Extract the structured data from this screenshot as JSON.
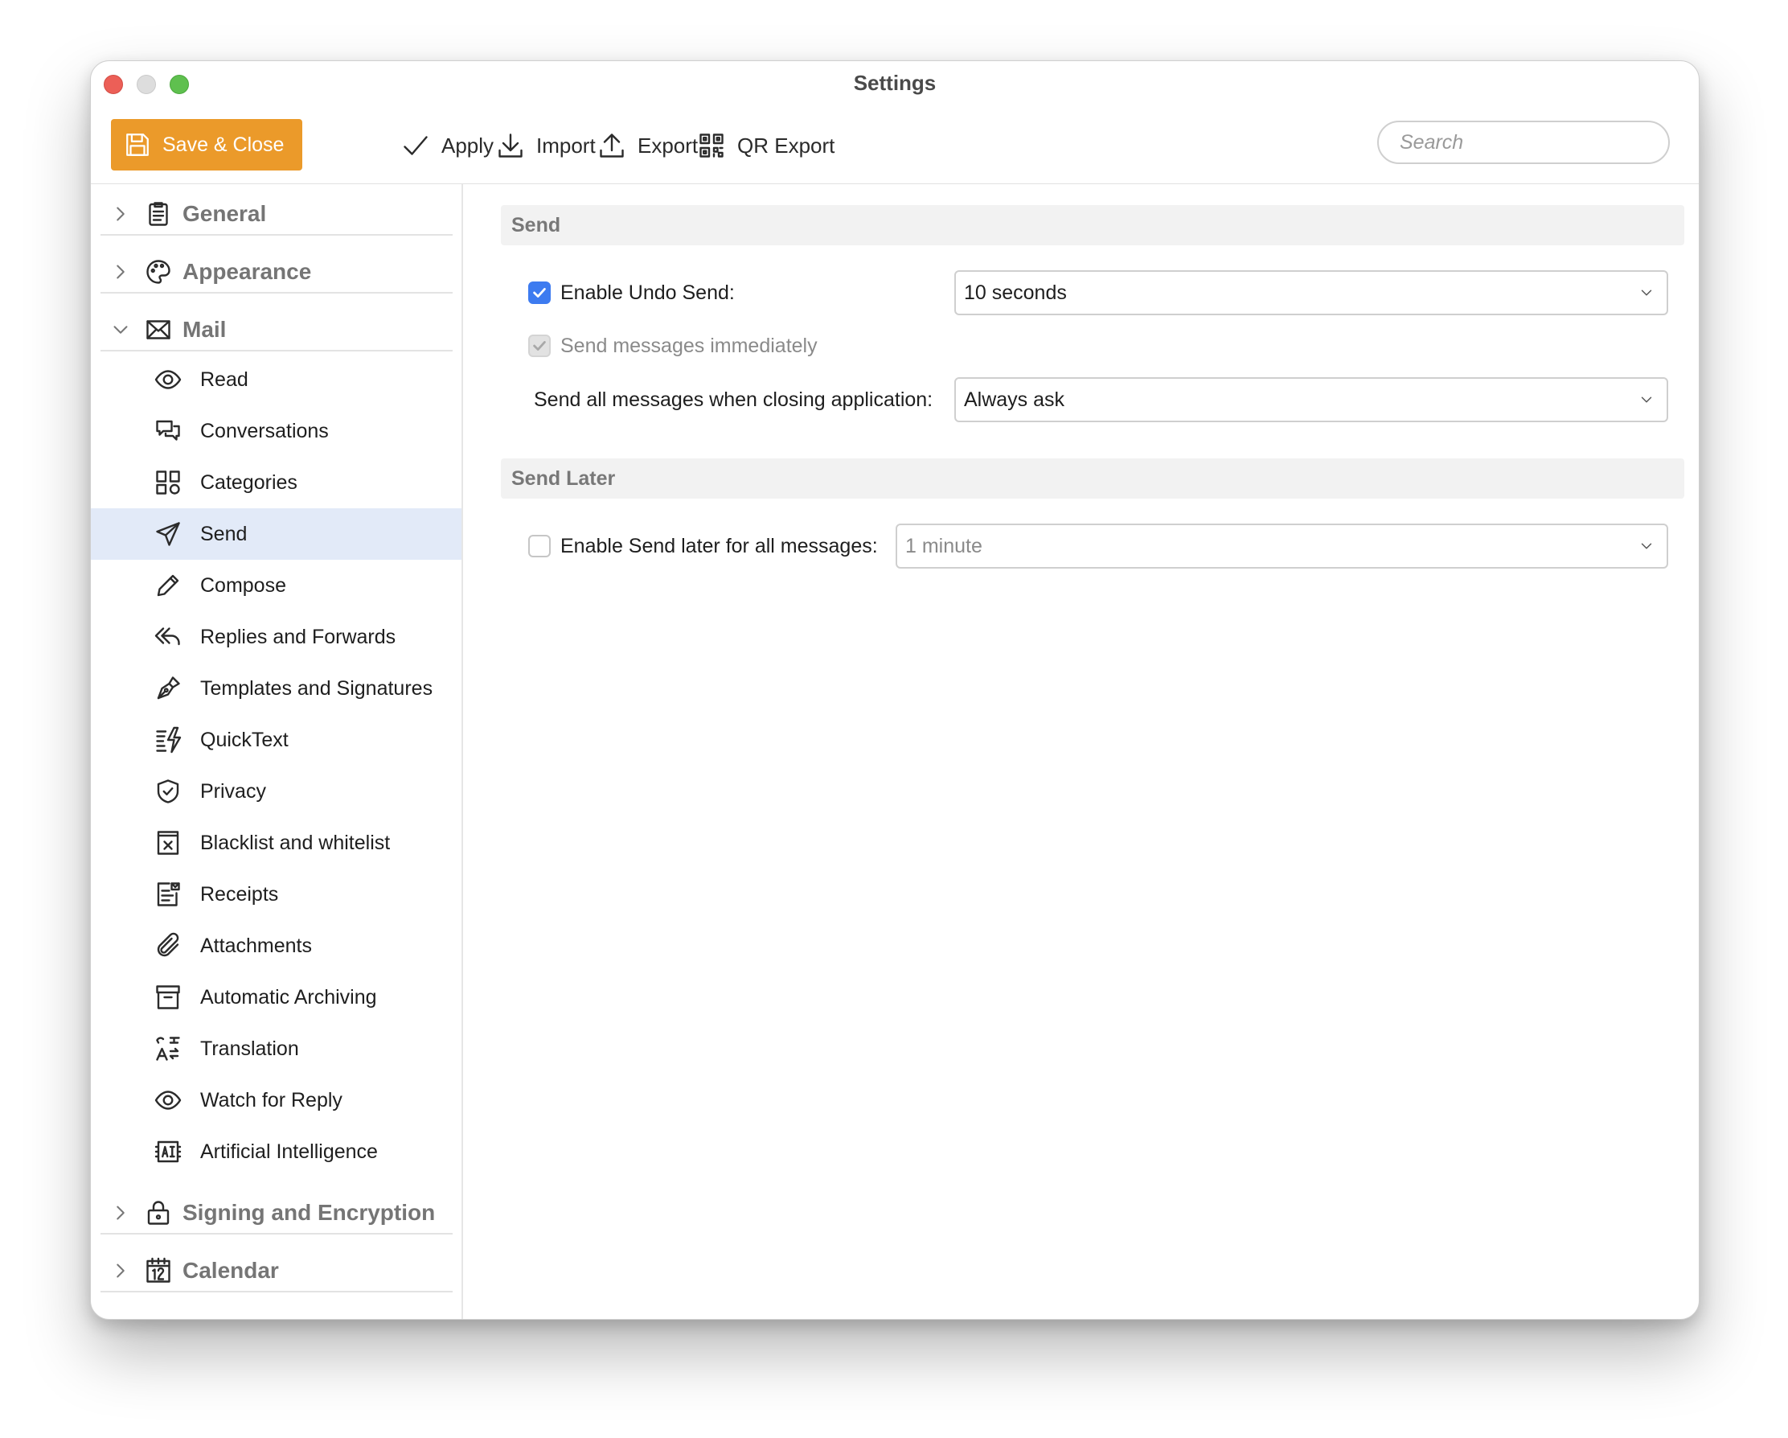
{
  "window": {
    "title": "Settings"
  },
  "toolbar": {
    "save_close": "Save & Close",
    "apply": "Apply",
    "import": "Import",
    "export": "Export",
    "qr_export": "QR Export",
    "search_placeholder": "Search"
  },
  "sidebar": {
    "sections": {
      "general": "General",
      "appearance": "Appearance",
      "mail": "Mail",
      "signing": "Signing and Encryption",
      "calendar": "Calendar"
    },
    "mail_items": [
      {
        "label": "Read",
        "icon": "eye-icon"
      },
      {
        "label": "Conversations",
        "icon": "chat-bubbles-icon"
      },
      {
        "label": "Categories",
        "icon": "grid-icon"
      },
      {
        "label": "Send",
        "icon": "paper-plane-icon",
        "selected": true
      },
      {
        "label": "Compose",
        "icon": "pencil-icon"
      },
      {
        "label": "Replies and Forwards",
        "icon": "reply-all-icon"
      },
      {
        "label": "Templates and Signatures",
        "icon": "fountain-pen-icon"
      },
      {
        "label": "QuickText",
        "icon": "quicktext-icon"
      },
      {
        "label": "Privacy",
        "icon": "shield-check-icon"
      },
      {
        "label": "Blacklist and whitelist",
        "icon": "blacklist-icon"
      },
      {
        "label": "Receipts",
        "icon": "receipt-icon"
      },
      {
        "label": "Attachments",
        "icon": "paperclip-icon"
      },
      {
        "label": "Automatic Archiving",
        "icon": "archive-box-icon"
      },
      {
        "label": "Translation",
        "icon": "translate-icon"
      },
      {
        "label": "Watch for Reply",
        "icon": "eye-icon"
      },
      {
        "label": "Artificial Intelligence",
        "icon": "ai-chip-icon"
      }
    ]
  },
  "content": {
    "send_header": "Send",
    "undo_send": {
      "label": "Enable Undo Send:",
      "checked": true,
      "value": "10 seconds"
    },
    "send_immediately": {
      "label": "Send messages immediately",
      "checked": true,
      "disabled": true
    },
    "send_on_close": {
      "label": "Send all messages when closing application:",
      "value": "Always ask"
    },
    "send_later_header": "Send Later",
    "send_later": {
      "label": "Enable Send later for all messages:",
      "checked": false,
      "value": "1 minute"
    }
  },
  "colors": {
    "accent_orange": "#eb9a2a",
    "checkbox_blue": "#3d7bf0",
    "selected_row": "#e2eaf8"
  }
}
